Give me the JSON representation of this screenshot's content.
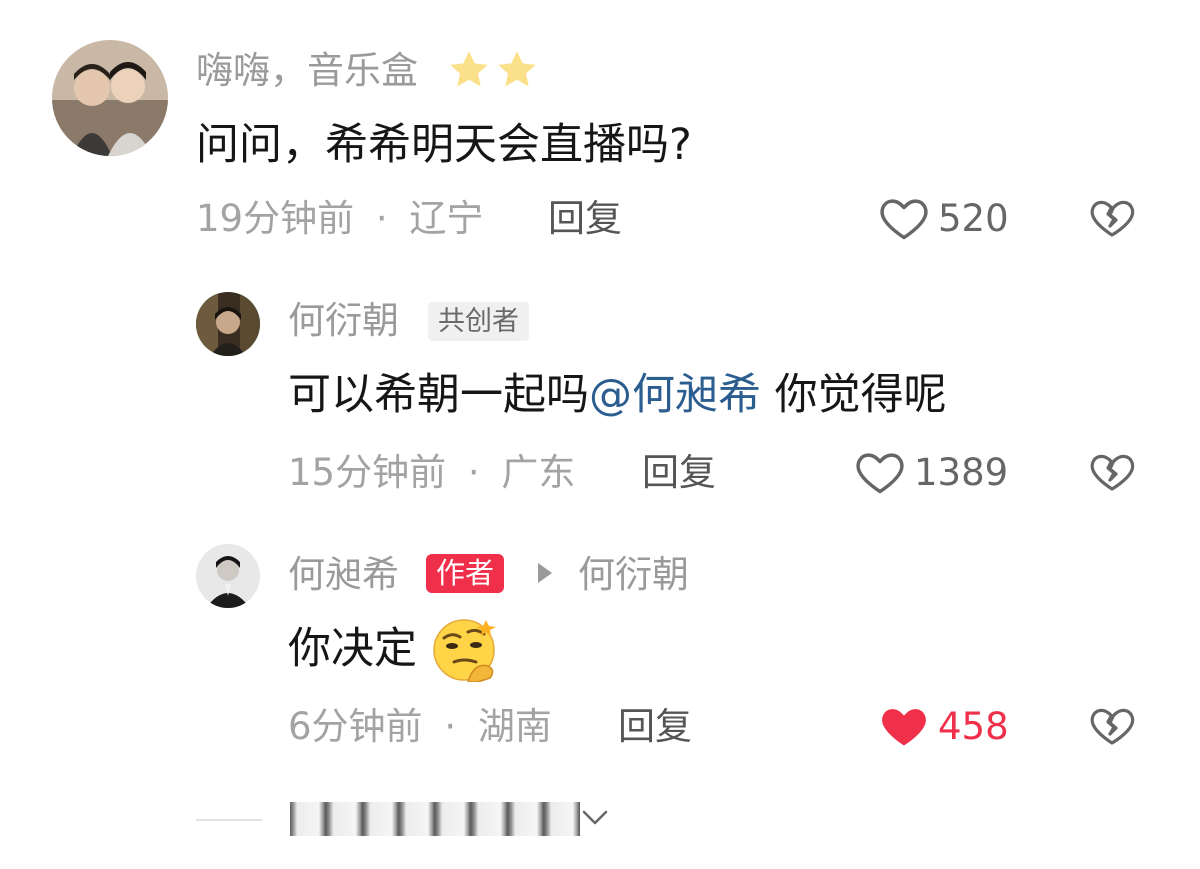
{
  "comments": [
    {
      "username": "嗨嗨，音乐盒",
      "stars": 2,
      "text": "问问，希希明天会直播吗?",
      "time": "19分钟前",
      "separator": "·",
      "location": "辽宁",
      "reply_label": "回复",
      "likes": "520",
      "liked": false
    },
    {
      "username": "何衍朝",
      "badge": "共创者",
      "text_before": "可以希朝一起吗",
      "mention": "@何昶希",
      "text_after": " 你觉得呢",
      "time": "15分钟前",
      "separator": "·",
      "location": "广东",
      "reply_label": "回复",
      "likes": "1389",
      "liked": false
    },
    {
      "username": "何昶希",
      "badge": "作者",
      "reply_to": "何衍朝",
      "text": "你决定",
      "emoji": "thinking-smirk-emoji",
      "time": "6分钟前",
      "separator": "·",
      "location": "湖南",
      "reply_label": "回复",
      "likes": "458",
      "liked": true
    }
  ],
  "colors": {
    "accent_red": "#f0304a",
    "mention_blue": "#2b5d8f",
    "gray_text": "#9a9a9a"
  }
}
